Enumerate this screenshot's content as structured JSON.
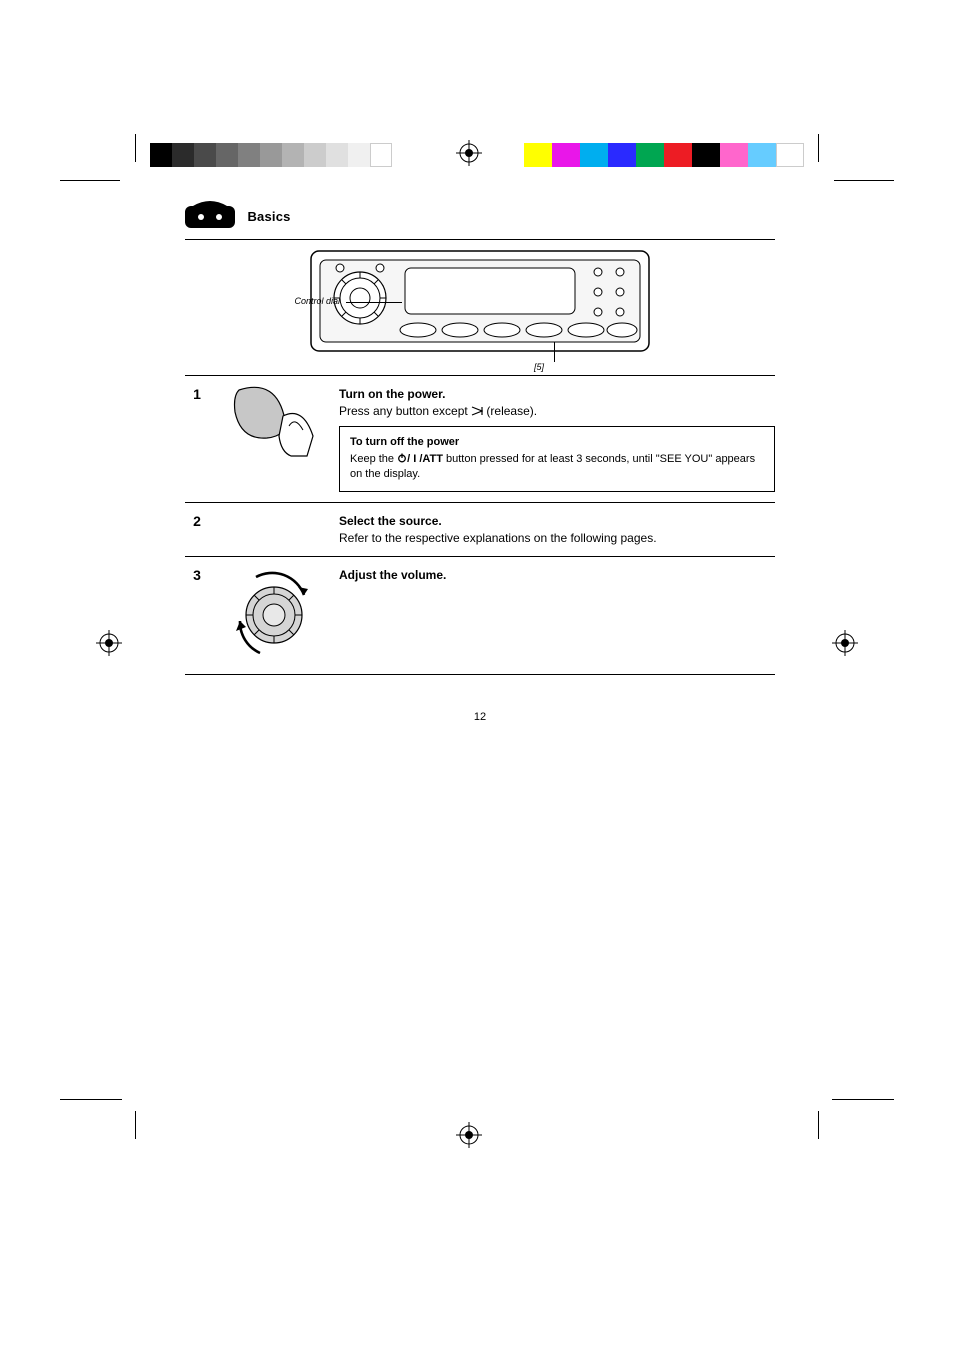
{
  "section": {
    "title": "Basics"
  },
  "diagram": {
    "callout1": "Control dial",
    "callout2": "[5]"
  },
  "steps": [
    {
      "num": "1",
      "title": "Turn on the power.",
      "body_prefix": "Press any button except ",
      "body_release_btn": "(release)",
      "body_suffix": "."
    },
    {
      "num": "",
      "note_title": "To turn off the power",
      "note_body_prefix": "Keep the ",
      "note_att": "/ I /ATT",
      "note_body_mid": " button pressed for at least 3 seconds, until \"SEE YOU\" appears on the display."
    },
    {
      "num": "2",
      "title": "Select the source.",
      "body": "Refer to the respective explanations on the following pages."
    },
    {
      "num": "3",
      "title": "Adjust the volume."
    }
  ],
  "page_number": "12",
  "colorbar": {
    "gray_shades": [
      "#000000",
      "#2b2b2b",
      "#4a4a4a",
      "#666666",
      "#808080",
      "#999999",
      "#b3b3b3",
      "#cccccc",
      "#e0e0e0",
      "#f0f0f0",
      "#ffffff"
    ],
    "colors": [
      "#ffff00",
      "#e916e9",
      "#00aeef",
      "#2a2aff",
      "#00a651",
      "#ed1c24",
      "#000000",
      "#ff66cc",
      "#66ccff",
      "#ffffff"
    ]
  }
}
